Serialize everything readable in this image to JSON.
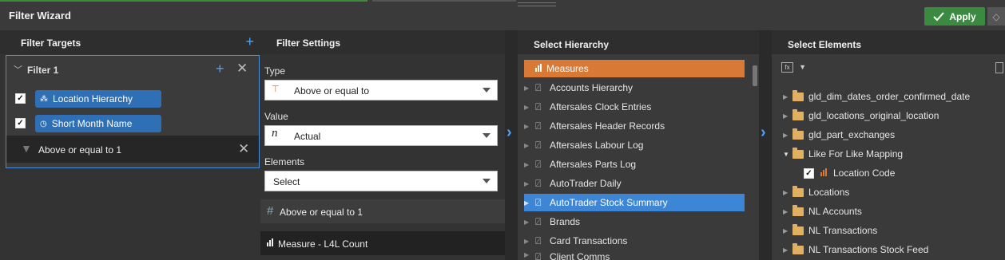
{
  "window": {
    "title": "Filter Wizard",
    "apply_label": "Apply"
  },
  "filter_targets": {
    "header": "Filter Targets",
    "filter": {
      "label": "Filter 1",
      "items": [
        {
          "label": "Location Hierarchy",
          "checked": true
        },
        {
          "label": "Short Month Name",
          "checked": true
        }
      ],
      "condition": "Above or equal to 1"
    }
  },
  "filter_settings": {
    "header": "Filter Settings",
    "type_label": "Type",
    "type_value": "Above or equal to",
    "value_label": "Value",
    "value_value": "Actual",
    "elements_label": "Elements",
    "elements_value": "Select",
    "summary_condition": "Above or equal to 1",
    "summary_measure": "Measure - L4L Count"
  },
  "select_hierarchy": {
    "header": "Select Hierarchy",
    "items": [
      {
        "label": "Measures",
        "state": "measure"
      },
      {
        "label": "Accounts Hierarchy"
      },
      {
        "label": "Aftersales Clock Entries"
      },
      {
        "label": "Aftersales Header Records"
      },
      {
        "label": "Aftersales Labour Log"
      },
      {
        "label": "Aftersales Parts Log"
      },
      {
        "label": "AutoTrader Daily"
      },
      {
        "label": "AutoTrader Stock Summary",
        "state": "selected"
      },
      {
        "label": "Brands"
      },
      {
        "label": "Card Transactions"
      },
      {
        "label": "Client Comms"
      }
    ]
  },
  "select_elements": {
    "header": "Select Elements",
    "items": [
      {
        "label": "gld_dim_dates_order_confirmed_date"
      },
      {
        "label": "gld_locations_original_location"
      },
      {
        "label": "gld_part_exchanges"
      },
      {
        "label": "Like For Like Mapping"
      },
      {
        "label": "Location Code"
      },
      {
        "label": "Locations"
      },
      {
        "label": "NL Accounts"
      },
      {
        "label": "NL Transactions"
      },
      {
        "label": "NL Transactions Stock Feed"
      }
    ]
  },
  "colors": {
    "accent": "#3d86d6",
    "apply": "#3a8b3f",
    "measure": "#d87a36"
  }
}
